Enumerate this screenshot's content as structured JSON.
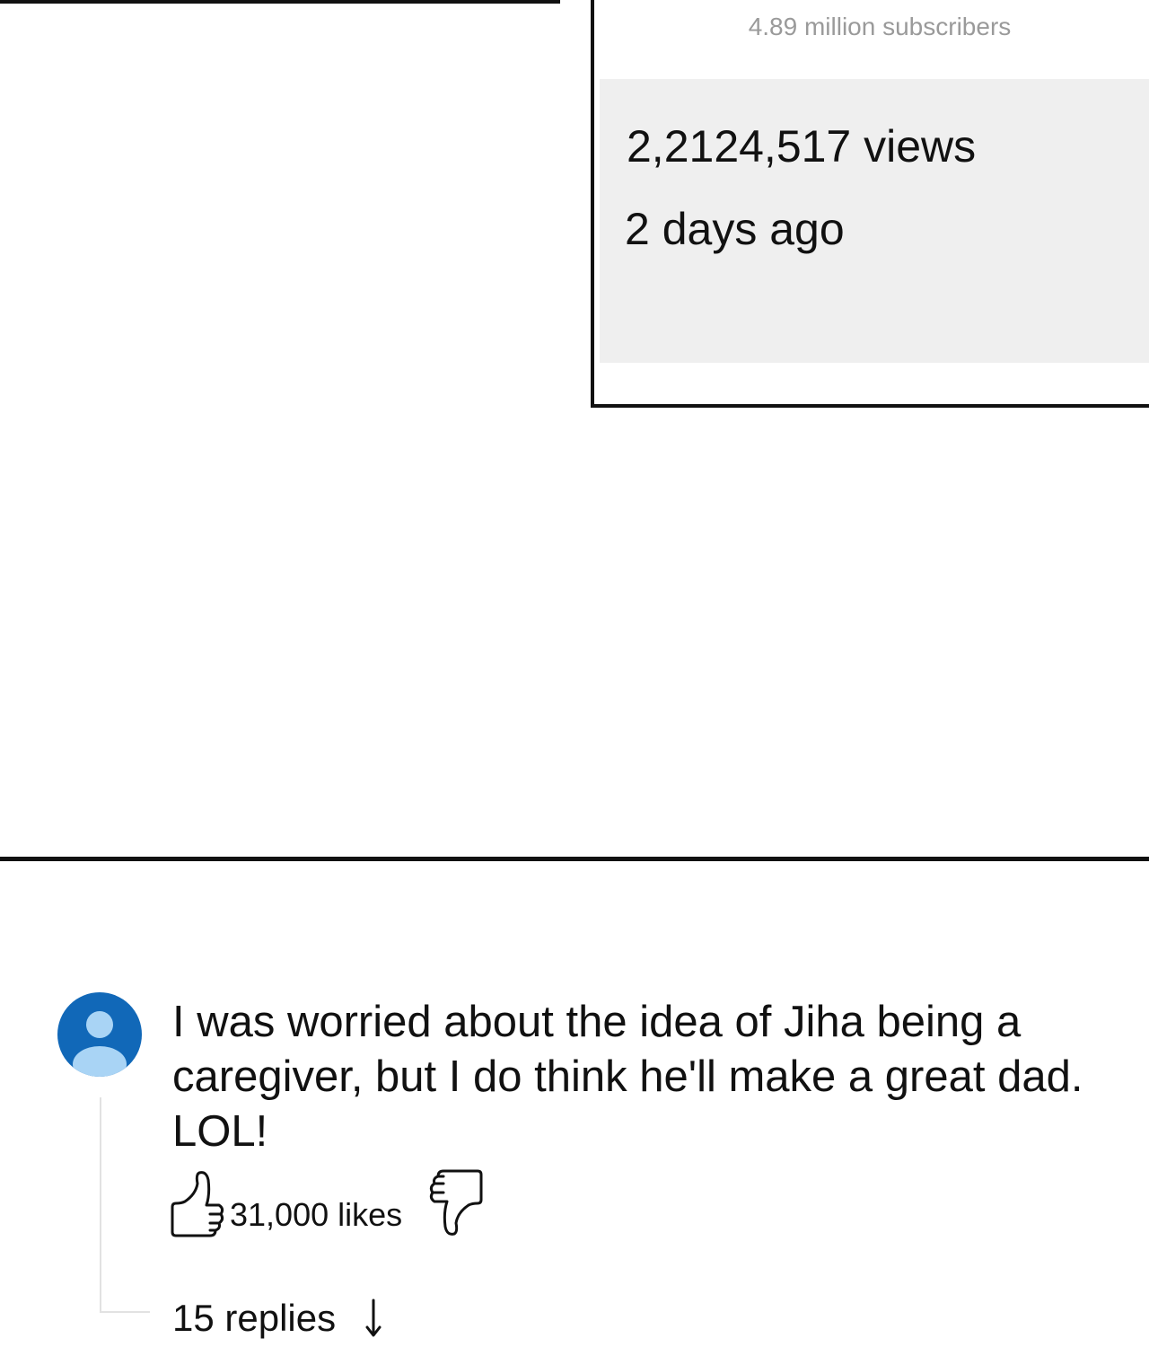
{
  "video": {
    "subscribers": "4.89 million subscribers",
    "views": "2,2124,517 views",
    "posted": "2 days ago"
  },
  "comment": {
    "text": "I was worried about the idea of Jiha being a caregiver, but I do think he'll make a great dad. LOL!",
    "likes": "31,000 likes",
    "replies": "15 replies"
  },
  "colors": {
    "avatar_bg": "#1168b8",
    "avatar_figure": "#a9d4f5",
    "stats_bg": "#efefef",
    "muted_text": "#9a9a9a"
  },
  "icons": {
    "like": "thumbs-up-icon",
    "dislike": "thumbs-down-icon",
    "avatar": "user-avatar-icon",
    "expand": "arrow-down-icon"
  }
}
